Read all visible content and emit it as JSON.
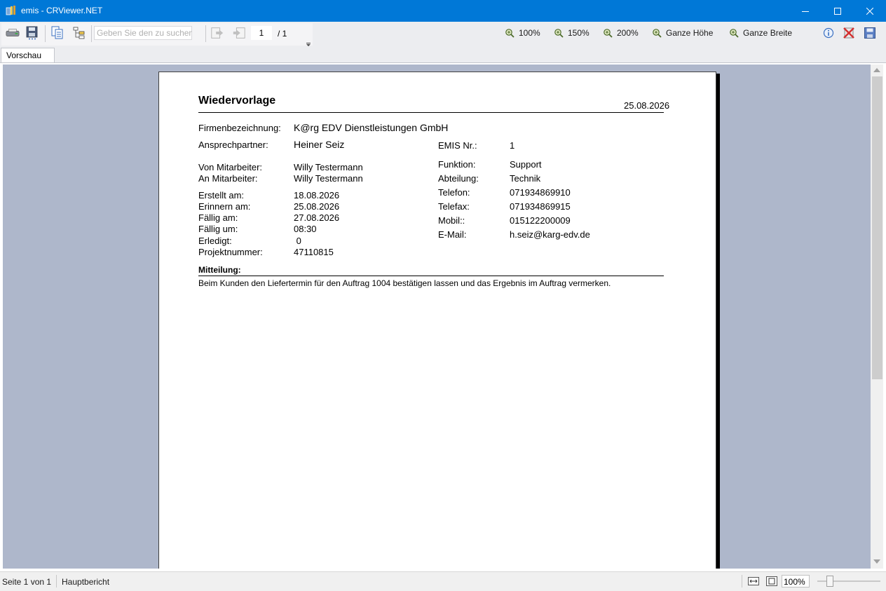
{
  "window": {
    "title": "emis - CRViewer.NET"
  },
  "toolbar": {
    "search_placeholder": "Geben Sie den zu suchenden Text ein",
    "page_current": "1",
    "page_total": "/ 1",
    "zoom_100": "100%",
    "zoom_150": "150%",
    "zoom_200": "200%",
    "zoom_fit_height": "Ganze Höhe",
    "zoom_fit_width": "Ganze Breite"
  },
  "tabs": [
    {
      "label": "Vorschau"
    }
  ],
  "report": {
    "title": "Wiedervorlage",
    "date": "25.08.2026",
    "fields_left": [
      {
        "label": "Firmenbezeichnung:",
        "value": "K@rg EDV Dienstleistungen GmbH"
      },
      {
        "label": "Ansprechpartner:",
        "value": "Heiner Seiz"
      },
      {
        "label": "Von Mitarbeiter:",
        "value": "Willy Testermann"
      },
      {
        "label": "An Mitarbeiter:",
        "value": "Willy Testermann"
      },
      {
        "label": "Erstellt am:",
        "value": "18.08.2026"
      },
      {
        "label": "Erinnern am:",
        "value": "25.08.2026"
      },
      {
        "label": "Fällig am:",
        "value": "27.08.2026"
      },
      {
        "label": "Fällig um:",
        "value": "08:30"
      },
      {
        "label": "Erledigt:",
        "value": " 0"
      },
      {
        "label": "Projektnummer:",
        "value": "47110815"
      }
    ],
    "fields_right": [
      {
        "label": "EMIS Nr.:",
        "value": "1"
      },
      {
        "label": "Funktion:",
        "value": "Support"
      },
      {
        "label": "Abteilung:",
        "value": "Technik"
      },
      {
        "label": "Telefon:",
        "value": "071934869910"
      },
      {
        "label": "Telefax:",
        "value": "071934869915"
      },
      {
        "label": "Mobil::",
        "value": "015122200009"
      },
      {
        "label": "E-Mail:",
        "value": "h.seiz@karg-edv.de"
      }
    ],
    "message_label": "Mitteilung:",
    "message_text": "Beim Kunden den Liefertermin für den Auftrag 1004 bestätigen lassen und das Ergebnis im Auftrag vermerken."
  },
  "statusbar": {
    "page_info": "Seite 1 von 1",
    "report_name": "Hauptbericht",
    "zoom": "100%"
  }
}
